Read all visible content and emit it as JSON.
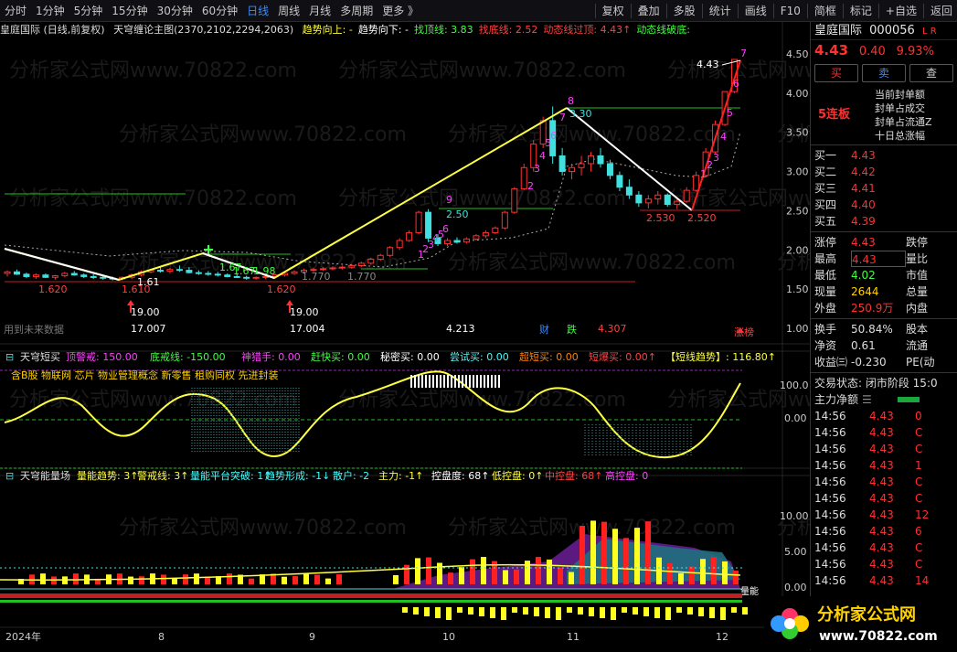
{
  "toolbar": {
    "left": [
      "分时",
      "1分钟",
      "5分钟",
      "15分钟",
      "30分钟",
      "60分钟",
      "日线",
      "周线",
      "月线",
      "多周期",
      "更多 》"
    ],
    "active": "日线",
    "right": [
      "复权",
      "叠加",
      "多股",
      "统计",
      "画线",
      "F10",
      "简框",
      "标记",
      "+自选",
      "返回"
    ]
  },
  "main_title": {
    "name": "皇庭国际 (日线,前复权)",
    "indicator": "天穹缠论主图(2370,2102,2294,2063)",
    "items": [
      {
        "text": "趋势向上: -",
        "color": "#ffff40"
      },
      {
        "text": "趋势向下: -",
        "color": "#ffffff"
      },
      {
        "text": "找顶线: 3.83",
        "color": "#40ff40"
      },
      {
        "text": "找底线: 2.52",
        "color": "#ff4040"
      },
      {
        "text": "动态线过顶: 4.43↑",
        "color": "#ff4040"
      },
      {
        "text": "动态线破底: ",
        "color": "#40ff40"
      }
    ]
  },
  "watermark": "分析家公式网www.70822.com",
  "future_label": "用到未来数据",
  "price_axis": [
    "4.50",
    "4.00",
    "3.50",
    "3.00",
    "2.50",
    "2.00",
    "1.50",
    "1.00"
  ],
  "price_marks": {
    "low1": "1.620",
    "low2": "1.610",
    "low3": "1.61",
    "low4": "1.620",
    "mid1": "1.770",
    "mid2": "1.770",
    "g1": "1.67",
    "g2": "1.67",
    "g3": "1.98",
    "b1": "2.50",
    "b2": "3.30",
    "l1": "2.530",
    "l2": "2.520",
    "top": "4.43",
    "v1": "19.00",
    "v2": "17.007",
    "v3": "19.00",
    "v4": "17.004",
    "v5": "4.213",
    "v6": "4.307",
    "cai": "财",
    "die": "跌",
    "zt": "涨榜"
  },
  "panel2": {
    "title": "天穹短买",
    "items": [
      {
        "text": "顶警戒: 150.00",
        "color": "#ff40ff"
      },
      {
        "text": "底戒线: -150.00",
        "color": "#40ff40"
      },
      {
        "text": "神猎手: 0.00",
        "color": "#ff40ff"
      },
      {
        "text": "赶快买: 0.00",
        "color": "#40ff40"
      },
      {
        "text": "秘密买: 0.00",
        "color": "#ffffff"
      },
      {
        "text": "尝试买: 0.00",
        "color": "#40ffff"
      },
      {
        "text": "超短买: 0.00",
        "color": "#ff8000"
      },
      {
        "text": "短爆买: 0.00↑",
        "color": "#ff4040"
      },
      {
        "text": "【短线趋势】: 116.80↑",
        "color": "#ffff40"
      }
    ],
    "tags": "含B股 物联网 芯片 物业管理概念 新零售 租购同权 先进封装",
    "axis": [
      "100.0",
      "0.00"
    ]
  },
  "panel3": {
    "title": "天穹能量场",
    "items": [
      {
        "text": "量能趋势: 3↑",
        "color": "#ffff40"
      },
      {
        "text": "警戒线: 3↑",
        "color": "#ffff40"
      },
      {
        "text": "量能平台突破: 1↑",
        "color": "#40ffff"
      },
      {
        "text": "趋势形成: -1↓",
        "color": "#40ffff"
      },
      {
        "text": "散户: -2",
        "color": "#40ffff"
      },
      {
        "text": "主力: -1↑",
        "color": "#ffff40"
      },
      {
        "text": "控盘度: 68↑",
        "color": "#ffffff"
      },
      {
        "text": "低控盘: 0↑",
        "color": "#ffff40"
      },
      {
        "text": "中控盘: 68↑",
        "color": "#ff4040"
      },
      {
        "text": "高控盘: 0",
        "color": "#ff40ff"
      }
    ],
    "axis": [
      "10.00",
      "5.00",
      "0.00"
    ],
    "side_label": "量能"
  },
  "date_axis": [
    "2024年",
    "8",
    "9",
    "10",
    "11",
    "12"
  ],
  "quote": {
    "name": "皇庭国际",
    "code": "000056",
    "flags": "L R",
    "price": "4.43",
    "change": "0.40",
    "pct": "9.93%",
    "buttons": [
      "买",
      "卖",
      "查"
    ],
    "limit_tag": "5连板",
    "seal": [
      "当前封单额",
      "封单占成交",
      "封单占流通Z",
      "十日总涨幅"
    ],
    "orders": [
      {
        "label": "买一",
        "price": "4.43"
      },
      {
        "label": "买二",
        "price": "4.42"
      },
      {
        "label": "买三",
        "price": "4.41"
      },
      {
        "label": "买四",
        "price": "4.40"
      },
      {
        "label": "买五",
        "price": "4.39"
      }
    ],
    "stats": [
      {
        "l1": "涨停",
        "v1": "4.43",
        "l2": "跌停"
      },
      {
        "l1": "最高",
        "v1": "4.43",
        "l2": "量比"
      },
      {
        "l1": "最低",
        "v1": "4.02",
        "l2": "市值"
      },
      {
        "l1": "现量",
        "v1": "2644",
        "l2": "总量"
      },
      {
        "l1": "外盘",
        "v1": "250.9万",
        "l2": "内盘"
      }
    ],
    "stats2": [
      {
        "l1": "换手",
        "v1": "50.84%",
        "l2": "股本"
      },
      {
        "l1": "净资",
        "v1": "0.61",
        "l2": "流通"
      },
      {
        "l1": "收益㈢",
        "v1": "-0.230",
        "l2": "PE(动"
      }
    ],
    "status": "交易状态: 闭市阶段 15:0",
    "net": "主力净额",
    "ticks": [
      {
        "t": "14:56",
        "p": "4.43",
        "v": "0"
      },
      {
        "t": "14:56",
        "p": "4.43",
        "v": "C"
      },
      {
        "t": "14:56",
        "p": "4.43",
        "v": "C"
      },
      {
        "t": "14:56",
        "p": "4.43",
        "v": "1"
      },
      {
        "t": "14:56",
        "p": "4.43",
        "v": "C"
      },
      {
        "t": "14:56",
        "p": "4.43",
        "v": "C"
      },
      {
        "t": "14:56",
        "p": "4.43",
        "v": "12"
      },
      {
        "t": "14:56",
        "p": "4.43",
        "v": "6"
      },
      {
        "t": "14:56",
        "p": "4.43",
        "v": "C"
      },
      {
        "t": "14:56",
        "p": "4.43",
        "v": "C"
      },
      {
        "t": "14:56",
        "p": "4.43",
        "v": "14"
      }
    ]
  },
  "logo": {
    "line1": "分析家公式网",
    "line2": "www.70822.com"
  }
}
